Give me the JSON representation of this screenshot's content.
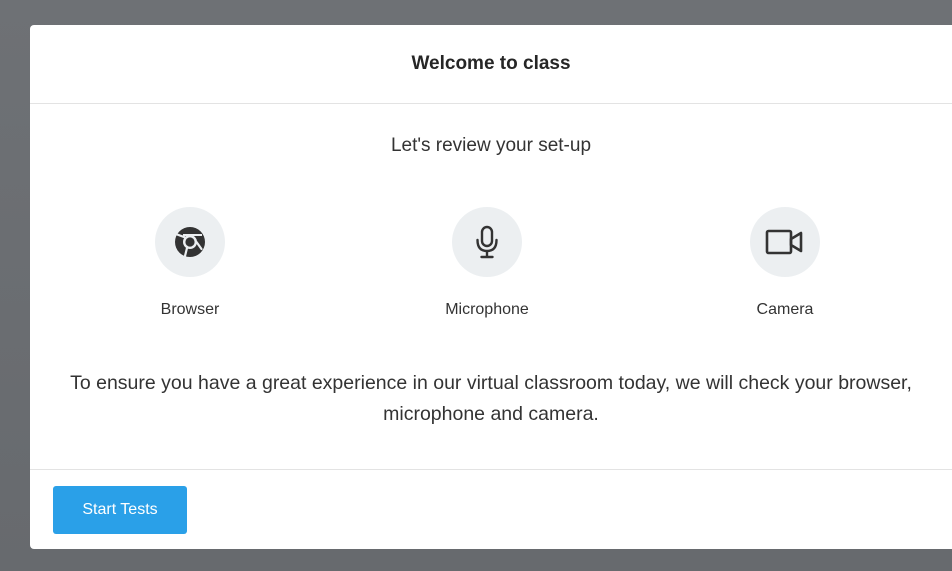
{
  "modal": {
    "title": "Welcome to class",
    "subtitle": "Let's review your set-up",
    "checks": [
      {
        "label": "Browser",
        "icon": "chrome-icon"
      },
      {
        "label": "Microphone",
        "icon": "microphone-icon"
      },
      {
        "label": "Camera",
        "icon": "video-camera-icon"
      }
    ],
    "description": "To ensure you have a great experience in our virtual classroom today, we will check your browser, microphone and camera.",
    "start_button_label": "Start Tests"
  },
  "colors": {
    "backdrop": "#6b6e72",
    "primary_button": "#2aa0e8",
    "icon_circle": "#eceff1",
    "icon": "#333333"
  }
}
